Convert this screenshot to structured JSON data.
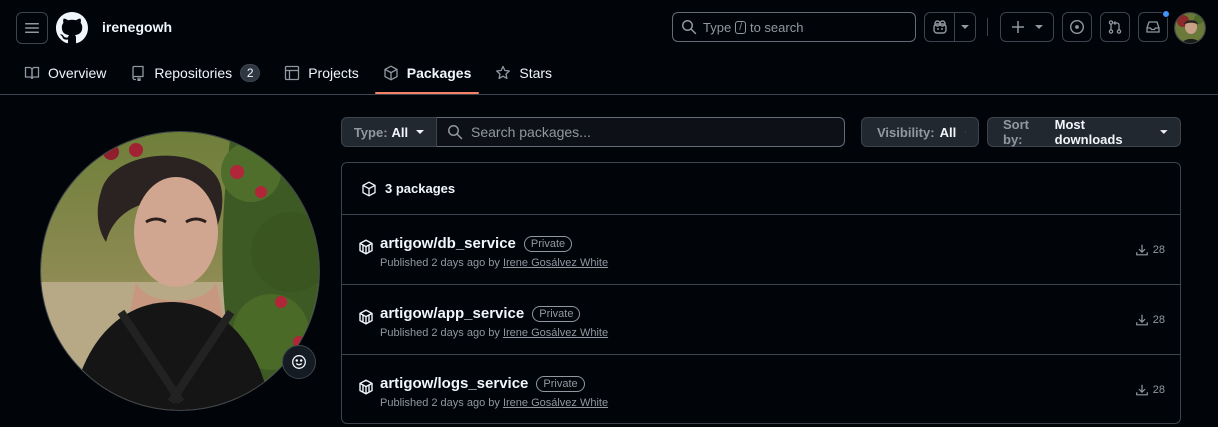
{
  "header": {
    "username": "irenegowh",
    "search": {
      "prefix": "Type",
      "key": "/",
      "suffix": "to search"
    }
  },
  "tabs": [
    {
      "label": "Overview",
      "icon": "book-icon"
    },
    {
      "label": "Repositories",
      "icon": "repo-icon",
      "count": "2"
    },
    {
      "label": "Projects",
      "icon": "table-icon"
    },
    {
      "label": "Packages",
      "icon": "package-icon",
      "selected": true
    },
    {
      "label": "Stars",
      "icon": "star-icon"
    }
  ],
  "filters": {
    "type_key": "Type:",
    "type_value": "All",
    "search_placeholder": "Search packages...",
    "visibility_key": "Visibility:",
    "visibility_value": "All",
    "sort_key": "Sort by:",
    "sort_value": "Most downloads"
  },
  "packages_header": "3 packages",
  "packages": [
    {
      "name": "artigow/db_service",
      "visibility": "Private",
      "published": "Published 2 days ago by",
      "author": "Irene Gosálvez White",
      "downloads": "28"
    },
    {
      "name": "artigow/app_service",
      "visibility": "Private",
      "published": "Published 2 days ago by",
      "author": "Irene Gosálvez White",
      "downloads": "28"
    },
    {
      "name": "artigow/logs_service",
      "visibility": "Private",
      "published": "Published 2 days ago by",
      "author": "Irene Gosálvez White",
      "downloads": "28"
    }
  ],
  "colors": {
    "accent_underline": "#f78166",
    "notification_dot": "#4493f8",
    "background": "#010409",
    "border": "#3d444d"
  }
}
